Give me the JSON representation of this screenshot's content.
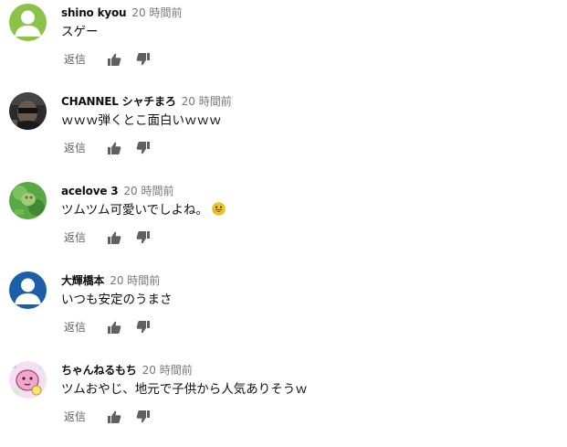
{
  "comments": [
    {
      "author": "shino kyou",
      "time": "20 時間前",
      "text": "スゲー",
      "avatar_icon": "default-green-avatar-icon",
      "has_emoji": false
    },
    {
      "author": "CHANNEL シャチまろ",
      "time": "20 時間前",
      "text": "ｗｗｗ弾くとこ面白いｗｗｗ",
      "avatar_icon": "dark-photo-avatar-icon",
      "has_emoji": false
    },
    {
      "author": "acelove 3",
      "time": "20 時間前",
      "text": "ツムツム可愛いでしよね。",
      "avatar_icon": "green-photo-avatar-icon",
      "has_emoji": true,
      "emoji_icon": "grinning-face-emoji-icon"
    },
    {
      "author": "大輝橋本",
      "time": "20 時間前",
      "text": "いつも安定のうまさ",
      "avatar_icon": "default-blue-avatar-icon",
      "has_emoji": false
    },
    {
      "author": "ちゃんねるもち",
      "time": "20 時間前",
      "text": "ツムおやじ、地元で子供から人気ありそうｗ",
      "avatar_icon": "pink-illustration-avatar-icon",
      "has_emoji": false
    }
  ],
  "actions": {
    "reply_label": "返信",
    "like_icon": "thumbs-up-icon",
    "dislike_icon": "thumbs-down-icon"
  },
  "colors": {
    "author": "#0f0f0f",
    "time": "#777777",
    "text": "#0f0f0f",
    "action": "#606060",
    "avatar_green": "#8bc34a",
    "avatar_blue": "#1a5fa8"
  }
}
